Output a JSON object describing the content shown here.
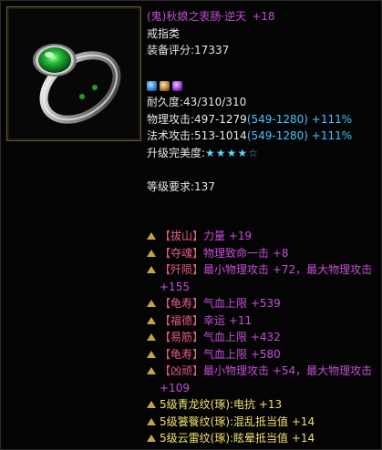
{
  "item": {
    "name": "(鬼)秋娘之衷肠·逆天",
    "enhance": "+18",
    "type": "戒指类",
    "score_label": "装备评分:",
    "score": "17337",
    "gem_icons": [
      "blue-gem-icon",
      "bronze-gem-icon",
      "purple-gem-icon"
    ],
    "durability_label": "耐久度:",
    "durability": "43/310/310",
    "phys_atk_label": "物理攻击:",
    "phys_atk_base": "497-1279",
    "phys_atk_bonus": "(549-1280)",
    "phys_atk_pct": "+111%",
    "mag_atk_label": "法术攻击:",
    "mag_atk_base": "513-1014",
    "mag_atk_bonus": "(549-1280)",
    "mag_atk_pct": "+111%",
    "upgrade_label": "升级完美度:",
    "upgrade_stars_filled": "★★★★",
    "upgrade_stars_empty": "☆",
    "upgrade_level": 4,
    "upgrade_max": 5,
    "level_req_label": "等级要求:",
    "level_req": "137"
  },
  "attributes": [
    {
      "prefix": "【拔山】",
      "text": "力量 +19"
    },
    {
      "prefix": "【夺魂】",
      "text": "物理致命一击 +8"
    },
    {
      "prefix": "【歼陨】",
      "text": "最小物理攻击 +72，最大物理攻击 +155"
    },
    {
      "prefix": "【龟寿】",
      "text": "气血上限 +539"
    },
    {
      "prefix": "【福德】",
      "text": "幸运 +11"
    },
    {
      "prefix": "【易筋】",
      "text": "气血上限 +432"
    },
    {
      "prefix": "【龟寿】",
      "text": "气血上限 +580"
    },
    {
      "prefix": "【凶顽】",
      "text": "最小物理攻击 +54，最大物理攻击 +109"
    }
  ],
  "patterns": [
    {
      "text": "5级青龙纹(琢):电抗 +13"
    },
    {
      "text": "5级饕餮纹(琢):混乱抵当值 +14"
    },
    {
      "text": "5级云雷纹(琢):眩晕抵当值 +14"
    }
  ],
  "colors": {
    "name": "#c64fd8",
    "bonus": "#3fc8ff",
    "attr_prefix": "#e05a8a",
    "pattern": "#f3e06a"
  }
}
